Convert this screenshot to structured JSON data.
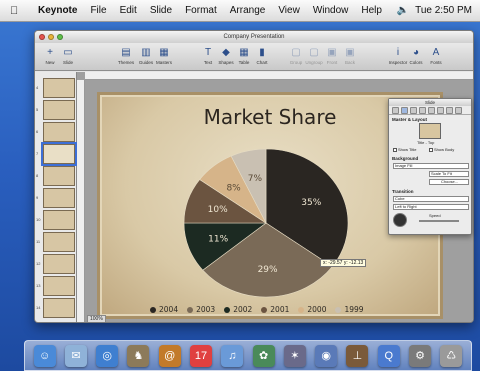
{
  "menubar": {
    "app": "Keynote",
    "items": [
      "File",
      "Edit",
      "Slide",
      "Format",
      "Arrange",
      "View",
      "Window",
      "Help"
    ],
    "time": "Tue 2:50 PM"
  },
  "window": {
    "title": "Company Presentation"
  },
  "toolbar": {
    "buttons": [
      {
        "label": "New",
        "icon": "new-slide-icon",
        "glyph": "+"
      },
      {
        "label": "Slide",
        "icon": "slide-icon",
        "glyph": "▭"
      },
      {
        "label": "Themes",
        "icon": "themes-icon",
        "glyph": "▤"
      },
      {
        "label": "Guides",
        "icon": "guides-icon",
        "glyph": "▥"
      },
      {
        "label": "Masters",
        "icon": "masters-icon",
        "glyph": "▦"
      },
      {
        "label": "Text",
        "icon": "text-icon",
        "glyph": "T"
      },
      {
        "label": "Shapes",
        "icon": "shapes-icon",
        "glyph": "◆"
      },
      {
        "label": "Table",
        "icon": "table-icon",
        "glyph": "▦"
      },
      {
        "label": "Chart",
        "icon": "chart-icon",
        "glyph": "▮"
      },
      {
        "label": "Group",
        "icon": "group-icon",
        "glyph": "▢"
      },
      {
        "label": "Ungroup",
        "icon": "ungroup-icon",
        "glyph": "▢"
      },
      {
        "label": "Front",
        "icon": "front-icon",
        "glyph": "▣"
      },
      {
        "label": "Back",
        "icon": "back-icon",
        "glyph": "▣"
      },
      {
        "label": "Inspector",
        "icon": "inspector-icon",
        "glyph": "i"
      },
      {
        "label": "Colors",
        "icon": "colors-icon",
        "glyph": "◕"
      },
      {
        "label": "Fonts",
        "icon": "fonts-icon",
        "glyph": "A"
      }
    ]
  },
  "navigator": {
    "slide_numbers": [
      "4",
      "5",
      "6",
      "7",
      "8",
      "9",
      "10",
      "11",
      "12",
      "13",
      "14"
    ],
    "selected_index": 3
  },
  "slide": {
    "title": "Market Share"
  },
  "chart_data": {
    "type": "pie",
    "title": "Market Share",
    "categories": [
      "2004",
      "2003",
      "2002",
      "2001",
      "2000",
      "1999"
    ],
    "values": [
      35,
      29,
      11,
      10,
      8,
      7
    ],
    "labels": [
      "35%",
      "29%",
      "11%",
      "10%",
      "8%",
      "7%"
    ],
    "colors": [
      "#2a2622",
      "#7a6a57",
      "#1c2a22",
      "#6b5440",
      "#d6b489",
      "#c9c0b2"
    ],
    "legend": [
      "2004",
      "2003",
      "2002",
      "2001",
      "2000",
      "1999"
    ],
    "legend_placement": "bottom"
  },
  "coord_tip": "x: -29.57  y: -12.13",
  "zoom": "100%",
  "inspector": {
    "title": "Slide",
    "section1": "Master & Layout",
    "master_name": "Title - Top",
    "show_title": "Show Title",
    "show_body": "Show Body",
    "section2": "Background",
    "background_value": "Image Fill",
    "fill_mode": "Scale To Fit",
    "choose": "Choose...",
    "section3": "Transition",
    "transition_value": "Cube",
    "direction": "Left to Right",
    "speed_label": "Speed"
  },
  "dock": {
    "items": [
      {
        "name": "finder-icon",
        "glyph": "☺",
        "color": "#4a8ad8"
      },
      {
        "name": "mail-icon",
        "glyph": "✉",
        "color": "#8fb2d8"
      },
      {
        "name": "safari-icon",
        "glyph": "◎",
        "color": "#3f7fd0"
      },
      {
        "name": "sherlock-icon",
        "glyph": "♞",
        "color": "#8c7a5a"
      },
      {
        "name": "address-book-icon",
        "glyph": "@",
        "color": "#c27a2a"
      },
      {
        "name": "ical-icon",
        "glyph": "17",
        "color": "#e04040"
      },
      {
        "name": "itunes-icon",
        "glyph": "♫",
        "color": "#6a9ad8"
      },
      {
        "name": "iphoto-icon",
        "glyph": "✿",
        "color": "#4a8a5a"
      },
      {
        "name": "imovie-icon",
        "glyph": "✶",
        "color": "#6a6a8a"
      },
      {
        "name": "idvd-icon",
        "glyph": "◉",
        "color": "#5a7ab8"
      },
      {
        "name": "keynote-icon",
        "glyph": "⊥",
        "color": "#7a5a3a"
      },
      {
        "name": "quicktime-icon",
        "glyph": "Q",
        "color": "#4a7acf"
      },
      {
        "name": "system-preferences-icon",
        "glyph": "⚙",
        "color": "#7a7a7a"
      },
      {
        "name": "trash-icon",
        "glyph": "♺",
        "color": "#9a9a9a"
      }
    ]
  }
}
